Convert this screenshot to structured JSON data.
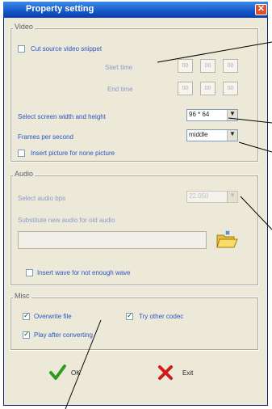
{
  "window": {
    "title": "Property setting",
    "close_glyph": "✕"
  },
  "video": {
    "group_label": "Video",
    "cut_label": "Cut source video snippet",
    "start_label": "Start time",
    "end_label": "End time",
    "time_placeholder": "00",
    "resolution_label": "Select screen width and height",
    "resolution_value": "96 * 64",
    "fps_label": "Frames per second",
    "fps_value": "middle",
    "insert_picture_label": "Insert picture for none picture"
  },
  "audio": {
    "group_label": "Audio",
    "bps_label": "Select audio bps",
    "bps_value": "22.050",
    "substitute_label": "Substitute new audio for old audio",
    "insert_wave_label": "Insert wave for not enough wave"
  },
  "misc": {
    "group_label": "Misc",
    "overwrite_label": "Overwrite file",
    "other_codec_label": "Try other codec",
    "play_after_label": "Play after converting"
  },
  "buttons": {
    "ok_label": "OK",
    "exit_label": "Exit"
  },
  "state": {
    "cut_checked": false,
    "insert_picture_checked": false,
    "insert_wave_checked": false,
    "overwrite_checked": true,
    "other_codec_checked": true,
    "play_after_checked": true
  }
}
